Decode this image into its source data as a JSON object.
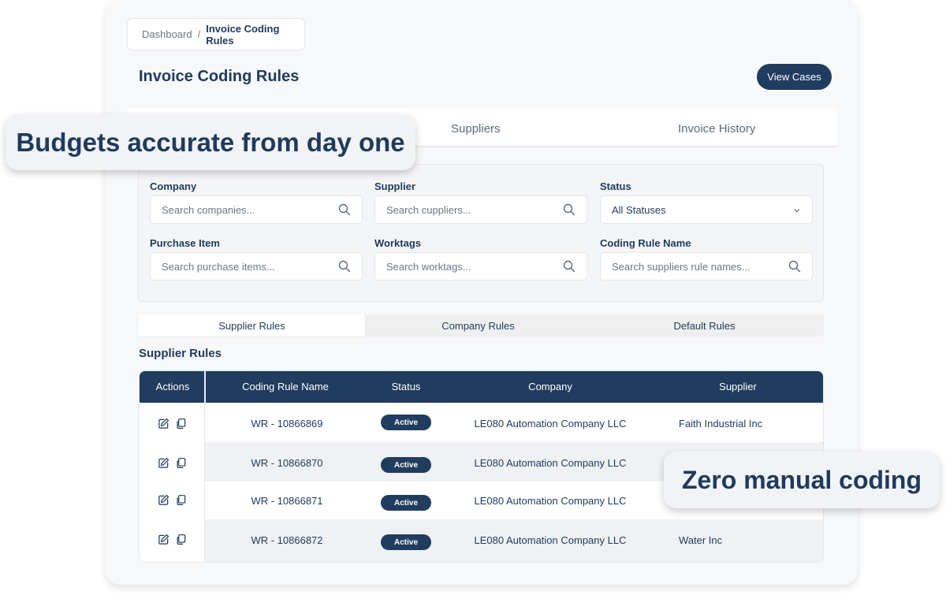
{
  "breadcrumb": {
    "home": "Dashboard",
    "separator": "/",
    "current": "Invoice Coding Rules"
  },
  "page": {
    "title": "Invoice Coding Rules",
    "view_cases_label": "View Cases"
  },
  "tabs": [
    {
      "label": "Suppliers"
    },
    {
      "label": "Invoice History"
    }
  ],
  "filters": {
    "company": {
      "label": "Company",
      "placeholder": "Search companies..."
    },
    "supplier": {
      "label": "Supplier",
      "placeholder": "Search cuppliers..."
    },
    "status": {
      "label": "Status",
      "value": "All Statuses"
    },
    "purchase_item": {
      "label": "Purchase Item",
      "placeholder": "Search purchase items..."
    },
    "worktags": {
      "label": "Worktags",
      "placeholder": "Search worktags..."
    },
    "coding_rule_name": {
      "label": "Coding Rule Name",
      "placeholder": "Search suppliers rule names..."
    }
  },
  "rule_tabs": [
    "Supplier Rules",
    "Company Rules",
    "Default Rules"
  ],
  "active_rule_tab": "Supplier Rules",
  "section_title": "Supplier Rules",
  "table": {
    "headers": [
      "Actions",
      "Coding Rule Name",
      "Status",
      "Company",
      "Supplier"
    ],
    "rows": [
      {
        "name": "WR - 10866869",
        "status": "Active",
        "company": "LE080 Automation Company LLC",
        "supplier": "Faith Industrial Inc"
      },
      {
        "name": "WR - 10866870",
        "status": "Active",
        "company": "LE080 Automation Company LLC",
        "supplier": ""
      },
      {
        "name": "WR - 10866871",
        "status": "Active",
        "company": "LE080 Automation Company LLC",
        "supplier": ""
      },
      {
        "name": "WR - 10866872",
        "status": "Active",
        "company": "LE080 Automation Company LLC",
        "supplier": "Water Inc"
      }
    ]
  },
  "callouts": {
    "top": "Budgets accurate from day one",
    "bottom": "Zero manual coding"
  },
  "icons": {
    "field_search": "search-icon",
    "status_dropdown": "chevron-down-icon",
    "row_edit": "edit-icon",
    "row_copy": "copy-icon"
  },
  "colors": {
    "primary": "#203c5e",
    "text": "#1f3a5c",
    "muted": "#6b7785",
    "row_alt": "#eff1f4"
  }
}
